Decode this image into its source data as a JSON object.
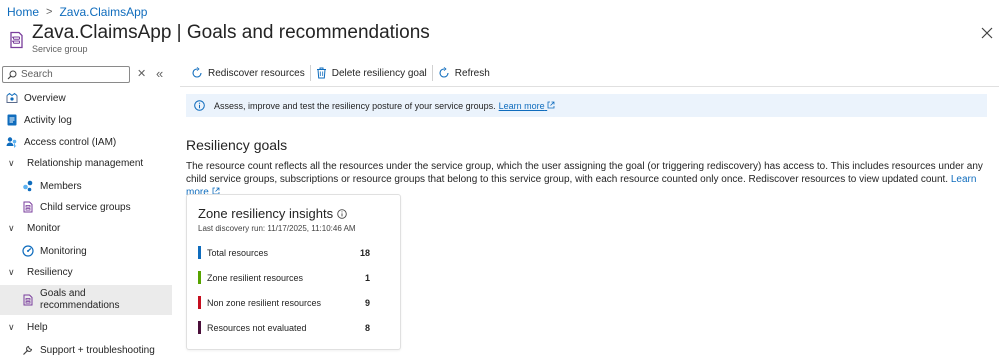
{
  "breadcrumb": {
    "home": "Home",
    "current": "Zava.ClaimsApp"
  },
  "header": {
    "title": "Zava.ClaimsApp | Goals and recommendations",
    "subtitle": "Service group"
  },
  "sidebar": {
    "search_placeholder": "Search",
    "items": [
      {
        "label": "Overview",
        "icon": "overview-icon"
      },
      {
        "label": "Activity log",
        "icon": "activity-log-icon"
      },
      {
        "label": "Access control (IAM)",
        "icon": "iam-icon"
      },
      {
        "label": "Relationship management",
        "icon": "chevron-down-icon"
      },
      {
        "label": "Members",
        "icon": "members-icon"
      },
      {
        "label": "Child service groups",
        "icon": "service-group-icon"
      },
      {
        "label": "Monitor",
        "icon": "chevron-down-icon"
      },
      {
        "label": "Monitoring",
        "icon": "monitoring-icon"
      },
      {
        "label": "Resiliency",
        "icon": "chevron-down-icon"
      },
      {
        "label": "Goals and recommendations",
        "label_line1": "Goals and",
        "label_line2": "recommendations",
        "icon": "goals-icon"
      },
      {
        "label": "Help",
        "icon": "chevron-down-icon"
      },
      {
        "label": "Support + troubleshooting",
        "icon": "support-icon"
      }
    ]
  },
  "toolbar": {
    "rediscover": "Rediscover resources",
    "delete_goal": "Delete resiliency goal",
    "refresh": "Refresh"
  },
  "info": {
    "text": "Assess, improve and test the resiliency posture of your service groups.",
    "link": "Learn more"
  },
  "content": {
    "section_title": "Resiliency goals",
    "description": "The resource count reflects all the resources under the service group, which the user assigning the goal (or triggering rediscovery) has access to. This includes resources under any child service groups, subscriptions or resource groups that belong to this service group, with each resource counted only once. Rediscover resources to view updated count.",
    "description_link": "Learn more"
  },
  "card": {
    "title": "Zone resiliency insights",
    "last_discovery": "Last discovery run: 11/17/2025, 11:10:46 AM",
    "metrics": [
      {
        "label": "Total resources",
        "value": "18",
        "color": "#0f6cbd"
      },
      {
        "label": "Zone resilient resources",
        "value": "1",
        "color": "#57a300"
      },
      {
        "label": "Non zone resilient resources",
        "value": "9",
        "color": "#c50f1f"
      },
      {
        "label": "Resources not evaluated",
        "value": "8",
        "color": "#4a0f3a"
      }
    ]
  },
  "colors": {
    "accent": "#0f6cbd",
    "info_bg": "#ebf3fc",
    "selected_bg": "#ebebeb"
  }
}
